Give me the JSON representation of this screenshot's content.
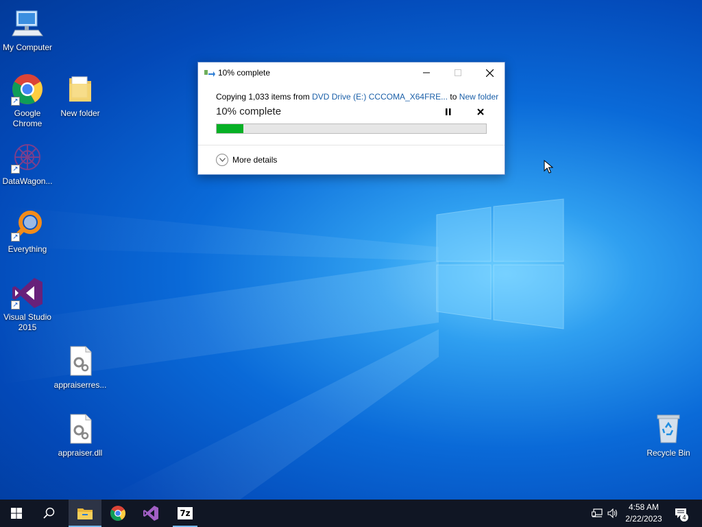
{
  "desktop": {
    "icons": [
      {
        "label": "My Computer",
        "icon": "computer-icon"
      },
      {
        "label": "Google Chrome",
        "icon": "chrome-icon"
      },
      {
        "label": "New folder",
        "icon": "folder-icon"
      },
      {
        "label": "DataWagon...",
        "icon": "datawagon-icon"
      },
      {
        "label": "Everything",
        "icon": "everything-search-icon"
      },
      {
        "label": "Visual Studio 2015",
        "icon": "visual-studio-icon"
      },
      {
        "label": "appraiserres...",
        "icon": "config-file-icon"
      },
      {
        "label": "appraiser.dll",
        "icon": "dll-file-icon"
      },
      {
        "label": "Recycle Bin",
        "icon": "recycle-bin-icon"
      }
    ]
  },
  "dialog": {
    "title": "10% complete",
    "copy_prefix": "Copying 1,033 items from ",
    "source": "DVD Drive (E:) CCCOMA_X64FRE...",
    "to_word": " to ",
    "destination": "New folder",
    "percent_text": "10% complete",
    "progress_percent": 10,
    "more_details": "More details",
    "progress_color": "#06b025"
  },
  "taskbar": {
    "apps": [
      "start-icon",
      "search-icon",
      "file-explorer-icon",
      "chrome-icon",
      "visual-studio-icon",
      "7zip-icon"
    ],
    "sevenzip_label": "7z",
    "time": "4:58 AM",
    "date": "2/22/2023",
    "notification_count": "4"
  }
}
